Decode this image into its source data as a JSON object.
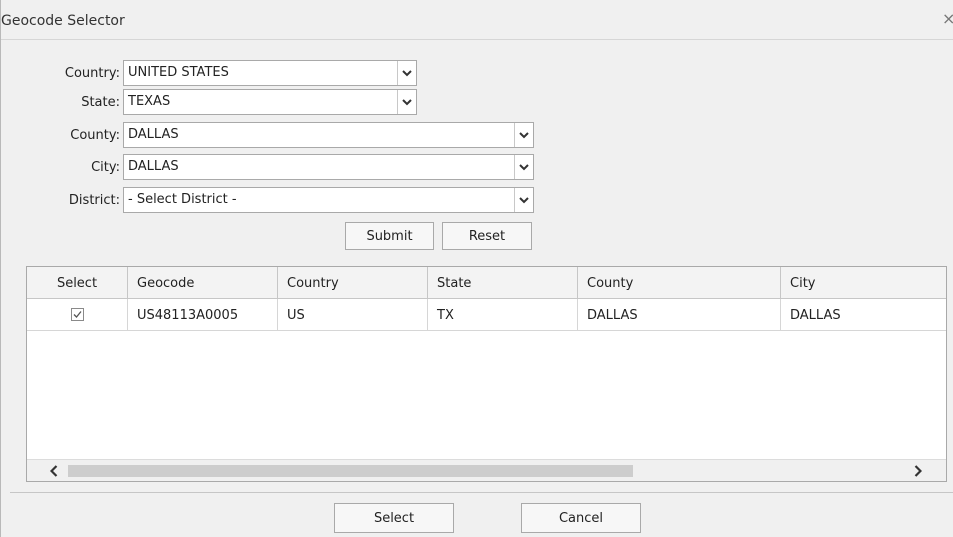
{
  "dialog": {
    "title": "Geocode Selector",
    "close_label": "×"
  },
  "form": {
    "country": {
      "label": "Country:",
      "value": "UNITED STATES"
    },
    "state": {
      "label": "State:",
      "value": "TEXAS"
    },
    "county": {
      "label": "County:",
      "value": "DALLAS"
    },
    "city": {
      "label": "City:",
      "value": "DALLAS"
    },
    "district": {
      "label": "District:",
      "value": "- Select District -"
    },
    "submit_label": "Submit",
    "reset_label": "Reset"
  },
  "grid": {
    "headers": [
      "Select",
      "Geocode",
      "Country",
      "State",
      "County",
      "City"
    ],
    "rows": [
      {
        "selected": true,
        "cells": [
          "US48113A0005",
          "US",
          "TX",
          "DALLAS",
          "DALLAS"
        ]
      }
    ]
  },
  "footer": {
    "select_label": "Select",
    "cancel_label": "Cancel"
  }
}
